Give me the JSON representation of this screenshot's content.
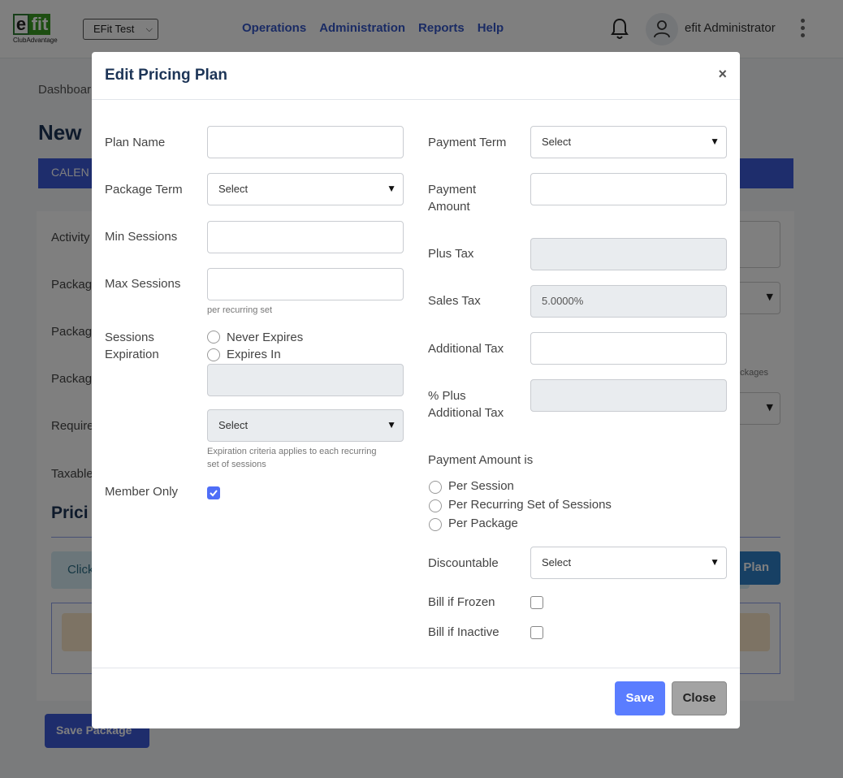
{
  "header": {
    "logo_mark": "efit",
    "logo_sub": "ClubAdvantage",
    "club_select": "EFit Test",
    "nav": [
      "Operations",
      "Administration",
      "Reports",
      "Help"
    ],
    "user_name": "efit Administrator"
  },
  "background": {
    "breadcrumb": "Dashboar",
    "title": "New",
    "tab": "CALEN",
    "labels": [
      "Activity",
      "Packag",
      "Packag",
      "Packag",
      "Require",
      "Taxable"
    ],
    "packages_hint": "ackages",
    "section_title": "Prici",
    "info_text": "Click",
    "plan_button": "Plan",
    "save_package": "Save Package"
  },
  "modal": {
    "title": "Edit Pricing Plan",
    "close_x": "×",
    "left": {
      "plan_name_label": "Plan Name",
      "plan_name_value": "",
      "package_term_label": "Package Term",
      "package_term_value": "Select",
      "min_sessions_label": "Min Sessions",
      "min_sessions_value": "",
      "max_sessions_label": "Max Sessions",
      "max_sessions_value": "",
      "max_sessions_hint": "per recurring set",
      "sessions_expiration_label_1": "Sessions",
      "sessions_expiration_label_2": "Expiration",
      "never_expires": "Never Expires",
      "expires_in": "Expires In",
      "expires_in_value": "",
      "expiration_unit_value": "Select",
      "expiration_hint_1": "Expiration criteria applies to each recurring",
      "expiration_hint_2": "set of sessions",
      "member_only_label": "Member Only",
      "member_only_checked": true
    },
    "right": {
      "payment_term_label": "Payment Term",
      "payment_term_value": "Select",
      "payment_amount_label_1": "Payment",
      "payment_amount_label_2": "Amount",
      "payment_amount_value": "",
      "plus_tax_label": "Plus Tax",
      "plus_tax_value": "",
      "sales_tax_label": "Sales Tax",
      "sales_tax_value": "5.0000%",
      "additional_tax_label": "Additional Tax",
      "additional_tax_value": "",
      "plus_additional_tax_label_1": "% Plus",
      "plus_additional_tax_label_2": "Additional Tax",
      "plus_additional_tax_value": "",
      "payment_amount_is_label": "Payment Amount is",
      "per_session": "Per Session",
      "per_recurring_set": "Per Recurring Set of Sessions",
      "per_package": "Per Package",
      "discountable_label": "Discountable",
      "discountable_value": "Select",
      "bill_if_frozen_label": "Bill if Frozen",
      "bill_if_inactive_label": "Bill if Inactive"
    },
    "footer": {
      "save": "Save",
      "close": "Close"
    }
  },
  "colors": {
    "primary": "#5a7dff",
    "nav": "#3557c9",
    "title": "#1d3557",
    "logo_green": "#3a9d23"
  }
}
